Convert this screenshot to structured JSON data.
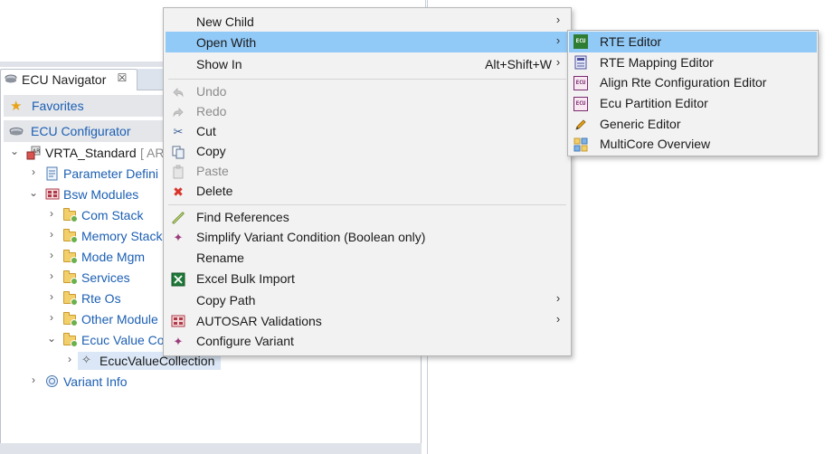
{
  "colors": {
    "link_blue": "#1c5fb3",
    "menu_highlight": "#91c9f7",
    "menu_background": "#f2f2f2",
    "disabled_text": "#8c8c8c",
    "selected_row": "#dbe7f7"
  },
  "navigator": {
    "tab_label": "ECU Navigator",
    "tab_close_glyph": "☒",
    "favorites_label": "Favorites",
    "configurator_label": "ECU Configurator",
    "tree": {
      "root_label": "VRTA_Standard",
      "root_suffix": "[ AR",
      "parameter_definitions": "Parameter Defini",
      "bsw_modules": "Bsw Modules",
      "com_stack": "Com Stack",
      "memory_stack": "Memory Stack",
      "mode_mgm": "Mode Mgm",
      "services": "Services",
      "rte_os": "Rte Os",
      "other_modules": "Other Module",
      "ecuc_value_co": "Ecuc Value Co",
      "ecuc_value_collection": "EcucValueCollection",
      "variant_info": "Variant Info"
    }
  },
  "context_menu": {
    "new_child": "New Child",
    "open_with": "Open With",
    "show_in": "Show In",
    "show_in_shortcut": "Alt+Shift+W",
    "undo": "Undo",
    "redo": "Redo",
    "cut": "Cut",
    "copy": "Copy",
    "paste": "Paste",
    "delete": "Delete",
    "find_references": "Find References",
    "simplify_variant": "Simplify Variant Condition (Boolean only)",
    "rename": "Rename",
    "excel_bulk_import": "Excel Bulk Import",
    "copy_path": "Copy Path",
    "autosar_validations": "AUTOSAR Validations",
    "configure_variant": "Configure Variant"
  },
  "open_with_submenu": {
    "rte_editor": "RTE Editor",
    "rte_mapping_editor": "RTE Mapping Editor",
    "align_rte_config_editor": "Align Rte Configuration Editor",
    "ecu_partition_editor": "Ecu Partition Editor",
    "generic_editor": "Generic Editor",
    "multicore_overview": "MultiCore Overview"
  },
  "icons": {
    "ecu_badge_text": "ECU",
    "chevron_right": "›",
    "chevron_down": "⌄",
    "tree_expanded": "⌄",
    "tree_collapsed": "›",
    "star": "★",
    "cut": "✂",
    "delete": "✖",
    "variant": "✦",
    "sparkle": "✧"
  }
}
